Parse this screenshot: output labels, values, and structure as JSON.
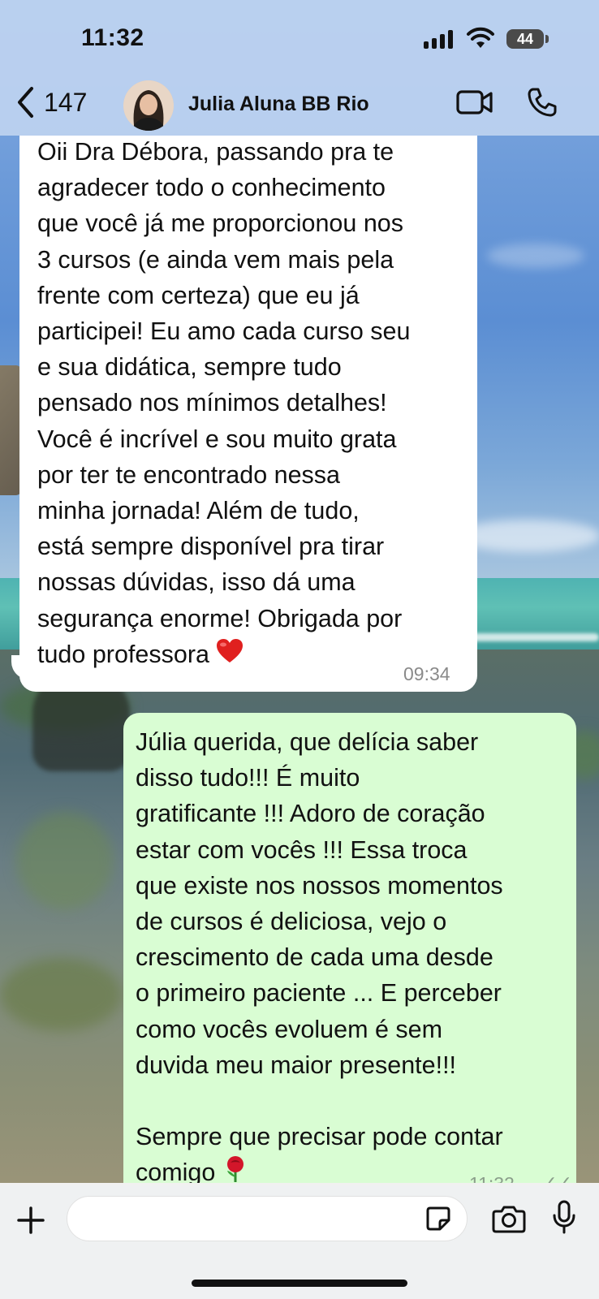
{
  "status_bar": {
    "time": "11:32",
    "battery": "44"
  },
  "header": {
    "back_count": "147",
    "contact_name": "Julia Aluna BB Rio",
    "icons": [
      "chevron-left-icon",
      "video-call-icon",
      "phone-icon"
    ]
  },
  "messages": [
    {
      "direction": "incoming",
      "text": "Oii Dra Débora, passando pra te\nagradecer todo o conhecimento\nque você já me proporcionou nos\n3 cursos (e ainda vem mais pela\nfrente com certeza) que eu já\nparticipei! Eu amo cada curso seu\ne sua didática, sempre tudo\npensado nos mínimos detalhes!\nVocê é incrível e sou muito grata\npor ter te encontrado nessa\nminha jornada! Além de tudo,\nestá sempre disponível pra tirar\nnossas dúvidas, isso dá uma\nsegurança enorme! Obrigada por\ntudo professora",
      "emoji": "❤️",
      "time": "09:34"
    },
    {
      "direction": "outgoing",
      "text": "Júlia querida, que delícia saber\ndisso tudo!!! É muito\ngratificante !!! Adoro de coração\nestar com vocês !!! Essa troca\nque existe nos nossos momentos\nde cursos é deliciosa, vejo o\ncrescimento de cada uma desde\no primeiro paciente ... E perceber\ncomo vocês evoluem é sem\nduvida meu maior presente!!!\n\nSempre que precisar pode contar\ncomigo",
      "emoji": "🌹",
      "time": "11:32",
      "ticks": "✓✓"
    }
  ],
  "composer": {
    "value": "",
    "icons": [
      "plus-icon",
      "sticker-icon",
      "camera-icon",
      "microphone-icon"
    ]
  },
  "colors": {
    "incoming_bubble": "#ffffff",
    "outgoing_bubble": "#d9fdd3",
    "header_bg": "#bed2f0"
  }
}
